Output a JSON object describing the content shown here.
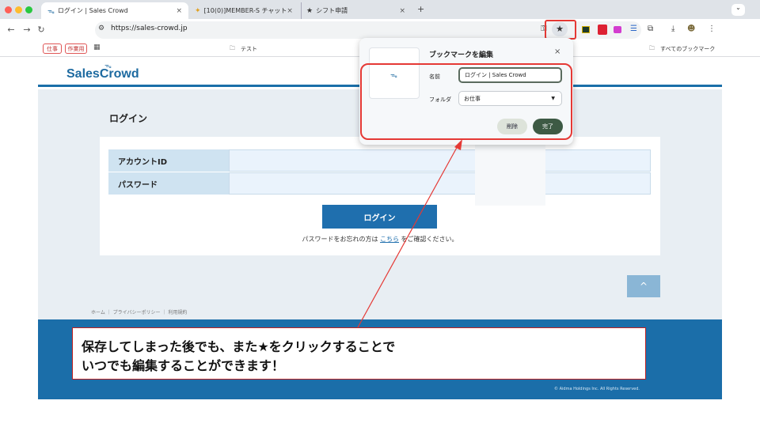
{
  "tabs": [
    {
      "label": "ログイン | Sales Crowd",
      "active": true
    },
    {
      "label": "[10(0)]MEMBER-S チャット",
      "active": false
    },
    {
      "label": "シフト申請",
      "active": false
    }
  ],
  "tab_add_label": "+",
  "tab_close_label": "×",
  "address": {
    "url": "https://sales-crowd.jp"
  },
  "bookmarks_bar": {
    "chips": [
      "仕事",
      "作業用"
    ],
    "folder": "テスト",
    "all_bookmarks": "すべてのブックマーク"
  },
  "site": {
    "logo": "SalesCrowd",
    "login_title": "ログイン",
    "account_label": "アカウントID",
    "password_label": "パスワード",
    "login_button": "ログイン",
    "forgot_prefix": "パスワードをお忘れの方は",
    "forgot_link": "こちら",
    "forgot_suffix": "をご確認ください。",
    "up_icon": "^",
    "footer_links": "ホーム ｜ プライバシーポリシー ｜ 利用規約",
    "copyright": "© Aidma Holdings Inc. All Rights Reserved."
  },
  "dialog": {
    "title": "ブックマークを編集",
    "close": "×",
    "name_label": "名前",
    "name_value": "ログイン | Sales Crowd",
    "folder_label": "フォルダ",
    "folder_value": "お仕事",
    "delete_button": "削除",
    "done_button": "完了"
  },
  "callout": {
    "line1": "保存してしまった後でも、また★をクリックすることで",
    "line2": "いつでも編集することができます！"
  },
  "colors": {
    "accent": "#1f6fae",
    "highlight": "#e53935",
    "done": "#3d5a44"
  }
}
